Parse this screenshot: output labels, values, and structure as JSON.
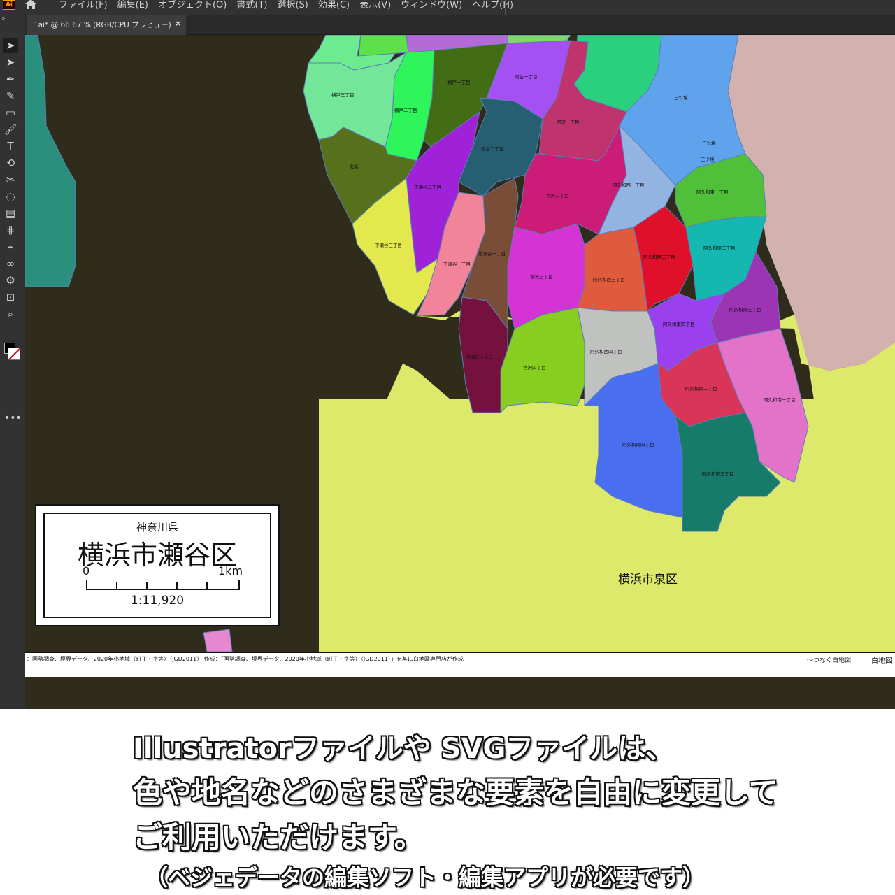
{
  "app": {
    "logo": "Ai",
    "menus": [
      "ファイル(F)",
      "編集(E)",
      "オブジェクト(O)",
      "書式(T)",
      "選択(S)",
      "効果(C)",
      "表示(V)",
      "ウィンドウ(W)",
      "ヘルプ(H)"
    ]
  },
  "document_tab": {
    "label": "1ai* @ 66.67 % (RGB/CPU プレビュー)",
    "close": "×"
  },
  "tools": [
    {
      "name": "selection-tool",
      "glyph": "➤",
      "active": true
    },
    {
      "name": "direct-selection-tool",
      "glyph": "➤"
    },
    {
      "name": "pen-tool",
      "glyph": "✒"
    },
    {
      "name": "curvature-tool",
      "glyph": "✎"
    },
    {
      "name": "rectangle-tool",
      "glyph": "▭"
    },
    {
      "name": "paintbrush-tool",
      "glyph": "🖌"
    },
    {
      "name": "type-tool",
      "glyph": "T"
    },
    {
      "name": "rotate-tool",
      "glyph": "⟲"
    },
    {
      "name": "scissors-tool",
      "glyph": "✂"
    },
    {
      "name": "lasso-tool",
      "glyph": "◌"
    },
    {
      "name": "gradient-tool",
      "glyph": "▤"
    },
    {
      "name": "mesh-tool",
      "glyph": "⋕"
    },
    {
      "name": "eyedropper-tool",
      "glyph": "⌁"
    },
    {
      "name": "blend-tool",
      "glyph": "∞"
    },
    {
      "name": "symbol-sprayer-tool",
      "glyph": "⚙"
    },
    {
      "name": "artboard-tool",
      "glyph": "⊡"
    },
    {
      "name": "zoom-tool",
      "glyph": "⌕"
    }
  ],
  "map": {
    "labels": {
      "l01": "横戸三丁目",
      "l02": "横戸二丁目",
      "l03": "横戸一丁目",
      "l04": "南台一丁目",
      "l05": "三ツ境",
      "l06": "北新",
      "l07": "南台二丁目",
      "l08": "宮沢一丁目",
      "l09": "三ツ境",
      "l10": "三ツ境",
      "l11": "下瀬谷二丁目",
      "l12": "宮沢二丁目",
      "l13": "阿久和西一丁目",
      "l14": "阿久和東一丁目",
      "l15": "下瀬谷三丁目",
      "l16": "下瀬谷一丁目",
      "l17": "南瀬谷一丁目",
      "l18": "宮沢三丁目",
      "l19": "阿久和西二丁目",
      "l20": "阿久和東二丁目",
      "l21": "阿久和西三丁目",
      "l22": "阿久和東三丁目",
      "l23": "阿久和東四丁目",
      "l24": "南瀬谷二丁目",
      "l25": "宮沢四丁目",
      "l26": "阿久和西四丁目",
      "l27": "阿久和南二丁目",
      "l28": "阿久和南一丁目",
      "l29": "阿久和南四丁目",
      "l30": "阿久和南三丁目"
    },
    "region_label": "横浜市泉区"
  },
  "legend": {
    "prefecture": "神奈川県",
    "city": "横浜市瀬谷区",
    "scale_start": "0",
    "scale_end": "1km",
    "ratio": "1:11,920"
  },
  "source": {
    "text": "：国勢調査、境界データ、2020年小地域（町丁・字等）（JGD2011） 作成：「国勢調査、境界データ、2020年小地域（町丁・字等）（JGD2011）」を基に白地図専門店が作成",
    "brand": "〜つなぐ白地図",
    "brand2": "白地図"
  },
  "caption": {
    "line1": "Illustratorファイルや SVGファイルは、",
    "line2": "色や地名などのさまざまな要素を自由に変更して",
    "line3": "ご利用いただけます。",
    "line4": "（ベジェデータの編集ソフト・編集アプリが必要です）"
  },
  "colors": {
    "ui_dark": "#323232",
    "canvas_outside": "#2f2c1c",
    "izumi": "#dde96a",
    "teal_left": "#2a8f7d",
    "pink_right": "#d3b1ae"
  }
}
